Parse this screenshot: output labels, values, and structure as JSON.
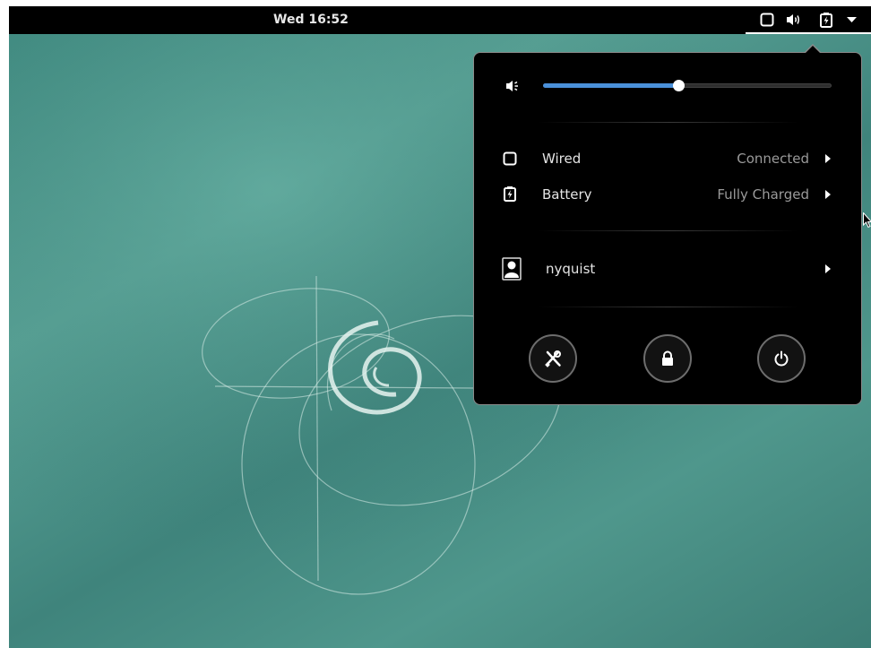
{
  "topbar": {
    "clock": "Wed 16:52",
    "icons": [
      "network-wired-icon",
      "volume-icon",
      "battery-icon",
      "dropdown-arrow-icon"
    ]
  },
  "menu": {
    "volume": {
      "icon": "volume-low-icon",
      "level": 0.47
    },
    "wired": {
      "icon": "network-wired-icon",
      "label": "Wired",
      "value": "Connected"
    },
    "battery": {
      "icon": "battery-charging-icon",
      "label": "Battery",
      "value": "Fully Charged"
    },
    "user": {
      "icon": "avatar-icon",
      "label": "nyquist"
    },
    "actions": [
      {
        "icon": "settings-icon"
      },
      {
        "icon": "lock-icon"
      },
      {
        "icon": "power-icon"
      }
    ]
  },
  "colors": {
    "topbar": "#000000",
    "popup_bg": "#000000",
    "slider_fill": "#4a90d9",
    "wallpaper": "#4f978c"
  }
}
